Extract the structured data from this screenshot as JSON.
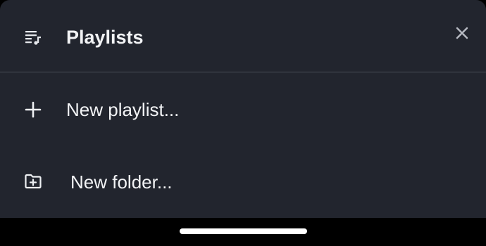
{
  "sheet": {
    "title": "Playlists",
    "header_icon": "playlist-icon",
    "close_icon": "close-icon"
  },
  "menu": {
    "items": [
      {
        "label": "New playlist...",
        "icon": "plus-icon"
      },
      {
        "label": "New folder...",
        "icon": "folder-plus-icon"
      }
    ]
  },
  "colors": {
    "sheet_background": "#22252e",
    "text": "#f2f3f5",
    "divider": "#4a4e58",
    "close_icon": "#b9bcc4",
    "nav_bar": "#000000"
  }
}
